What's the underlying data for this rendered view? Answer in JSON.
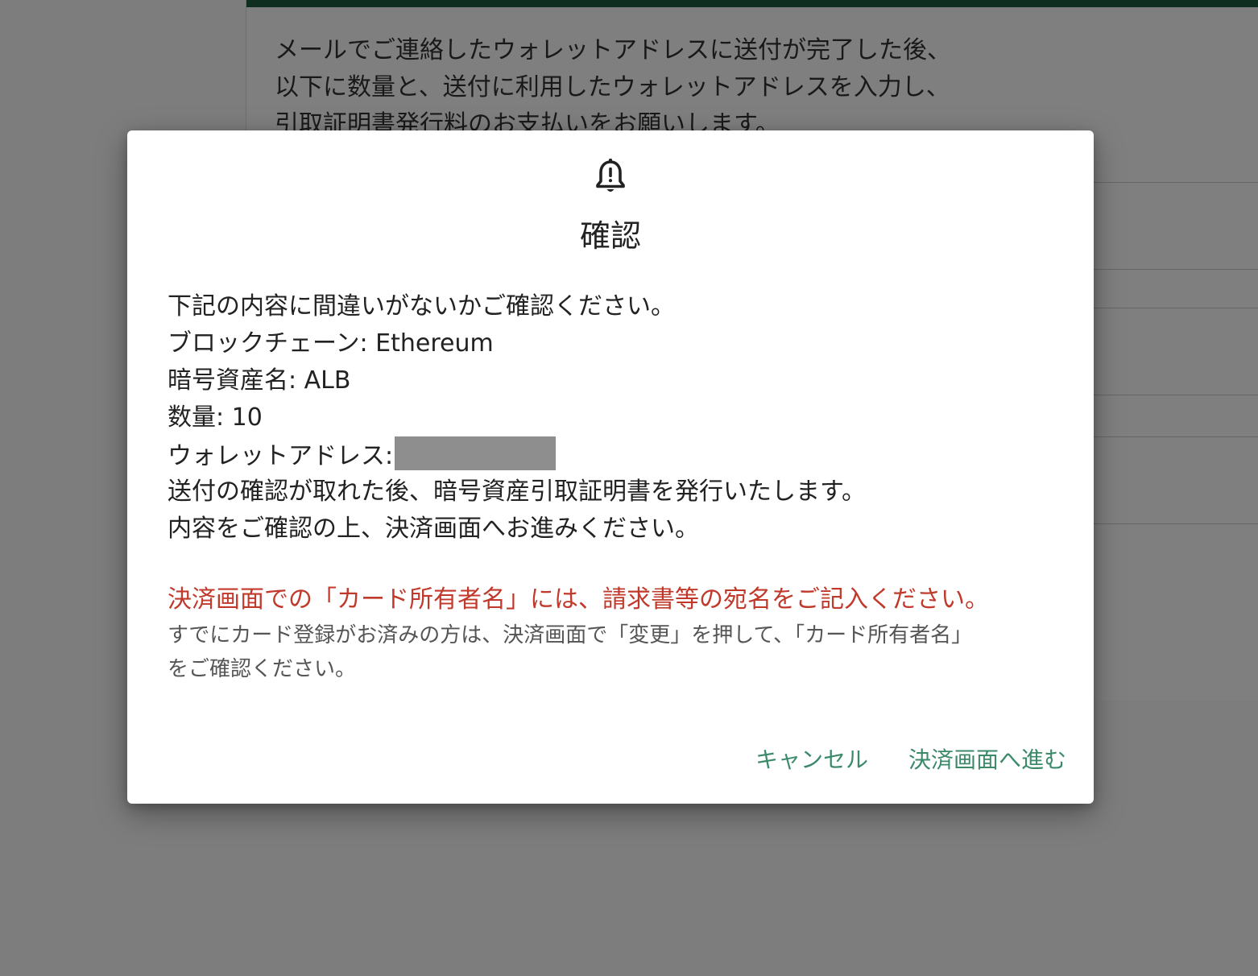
{
  "background": {
    "intro_lines": [
      "メールでご連絡したウォレットアドレスに送付が完了した後、",
      "以下に数量と、送付に利用したウォレットアドレスを入力し、",
      "引取証明書発行料のお支払いをお願いします。"
    ],
    "accent_color": "#1f5c3f"
  },
  "dialog": {
    "icon": "bell-alert-icon",
    "title": "確認",
    "body": {
      "intro": "下記の内容に間違いがないかご確認ください。",
      "blockchain": "ブロックチェーン: Ethereum",
      "asset_name": "暗号資産名: ALB",
      "quantity": "数量: 10",
      "wallet_label": "ウォレットアドレス:",
      "note1": "送付の確認が取れた後、暗号資産引取証明書を発行いたします。",
      "note2": "内容をご確認の上、決済画面へお進みください。"
    },
    "notice": {
      "warning": "決済画面での「カード所有者名」には、請求書等の宛名をご記入ください。",
      "sub_line1": "すでにカード登録がお済みの方は、決済画面で「変更」を押して、「カード所有者名」",
      "sub_line2": "をご確認ください。"
    },
    "actions": {
      "cancel": "キャンセル",
      "proceed": "決済画面へ進む"
    },
    "colors": {
      "warning": "#c0392b",
      "action": "#3b8a6a"
    }
  }
}
